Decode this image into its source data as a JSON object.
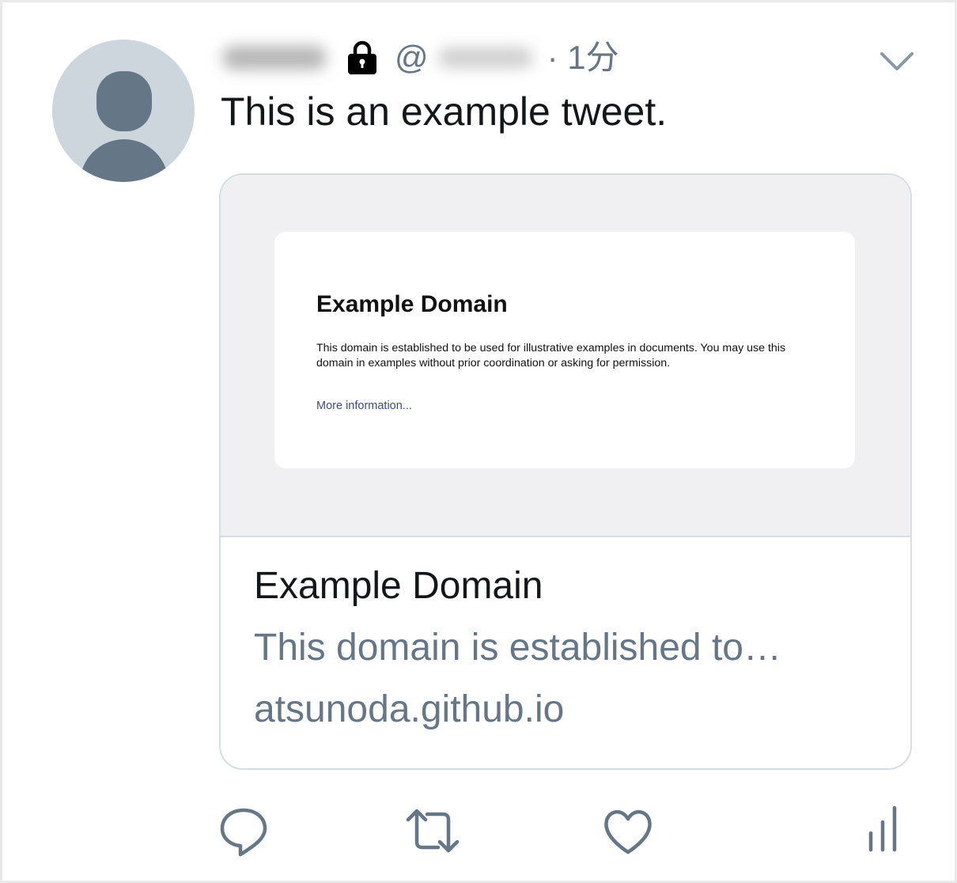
{
  "tweet": {
    "handle_prefix": "@",
    "timestamp": "· 1分",
    "text": "This is an example tweet.",
    "protected_icon": "lock-icon",
    "menu_icon": "chevron-down-icon"
  },
  "card": {
    "preview": {
      "heading": "Example Domain",
      "body": "This domain is established to be used for illustrative examples in documents. You may use this domain in examples without prior coordination or asking for permission.",
      "link": "More information..."
    },
    "title": "Example Domain",
    "description": "This domain is established to…",
    "domain": "atsunoda.github.io"
  },
  "actions": {
    "icons": [
      "reply-icon",
      "retweet-icon",
      "like-icon",
      "analytics-icon"
    ],
    "icon_color": "#657786"
  },
  "colors": {
    "text": "#14171a",
    "secondary": "#657786",
    "border": "#d6dde3",
    "avatar_bg": "#cdd6dd",
    "avatar_fg": "#657786"
  }
}
